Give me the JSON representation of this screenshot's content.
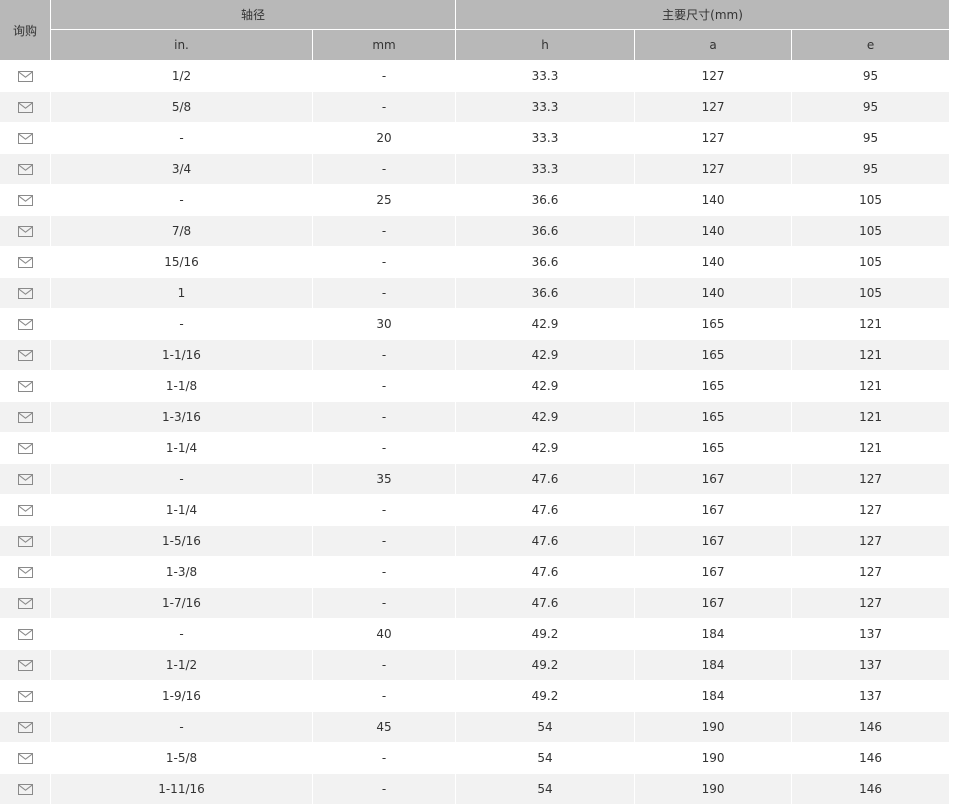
{
  "header": {
    "inquiry": "询购",
    "shaft_group": "轴径",
    "dims_group": "主要尺寸(mm)",
    "columns": [
      "in.",
      "mm",
      "h",
      "a",
      "e"
    ]
  },
  "rows": [
    {
      "in": "1/2",
      "mm": "-",
      "h": "33.3",
      "a": "127",
      "e": "95"
    },
    {
      "in": "5/8",
      "mm": "-",
      "h": "33.3",
      "a": "127",
      "e": "95"
    },
    {
      "in": "-",
      "mm": "20",
      "h": "33.3",
      "a": "127",
      "e": "95"
    },
    {
      "in": "3/4",
      "mm": "-",
      "h": "33.3",
      "a": "127",
      "e": "95"
    },
    {
      "in": "-",
      "mm": "25",
      "h": "36.6",
      "a": "140",
      "e": "105"
    },
    {
      "in": "7/8",
      "mm": "-",
      "h": "36.6",
      "a": "140",
      "e": "105"
    },
    {
      "in": "15/16",
      "mm": "-",
      "h": "36.6",
      "a": "140",
      "e": "105"
    },
    {
      "in": "1",
      "mm": "-",
      "h": "36.6",
      "a": "140",
      "e": "105"
    },
    {
      "in": "-",
      "mm": "30",
      "h": "42.9",
      "a": "165",
      "e": "121"
    },
    {
      "in": "1-1/16",
      "mm": "-",
      "h": "42.9",
      "a": "165",
      "e": "121"
    },
    {
      "in": "1-1/8",
      "mm": "-",
      "h": "42.9",
      "a": "165",
      "e": "121"
    },
    {
      "in": "1-3/16",
      "mm": "-",
      "h": "42.9",
      "a": "165",
      "e": "121"
    },
    {
      "in": "1-1/4",
      "mm": "-",
      "h": "42.9",
      "a": "165",
      "e": "121"
    },
    {
      "in": "-",
      "mm": "35",
      "h": "47.6",
      "a": "167",
      "e": "127"
    },
    {
      "in": "1-1/4",
      "mm": "-",
      "h": "47.6",
      "a": "167",
      "e": "127"
    },
    {
      "in": "1-5/16",
      "mm": "-",
      "h": "47.6",
      "a": "167",
      "e": "127"
    },
    {
      "in": "1-3/8",
      "mm": "-",
      "h": "47.6",
      "a": "167",
      "e": "127"
    },
    {
      "in": "1-7/16",
      "mm": "-",
      "h": "47.6",
      "a": "167",
      "e": "127"
    },
    {
      "in": "-",
      "mm": "40",
      "h": "49.2",
      "a": "184",
      "e": "137"
    },
    {
      "in": "1-1/2",
      "mm": "-",
      "h": "49.2",
      "a": "184",
      "e": "137"
    },
    {
      "in": "1-9/16",
      "mm": "-",
      "h": "49.2",
      "a": "184",
      "e": "137"
    },
    {
      "in": "-",
      "mm": "45",
      "h": "54",
      "a": "190",
      "e": "146"
    },
    {
      "in": "1-5/8",
      "mm": "-",
      "h": "54",
      "a": "190",
      "e": "146"
    },
    {
      "in": "1-11/16",
      "mm": "-",
      "h": "54",
      "a": "190",
      "e": "146"
    }
  ],
  "icons": {
    "inquiry_row": "envelope-icon"
  },
  "colors": {
    "header_bg": "#b8b8b8",
    "row_alt_bg": "#f2f2f2",
    "icon_stroke": "#8a8a8a"
  }
}
